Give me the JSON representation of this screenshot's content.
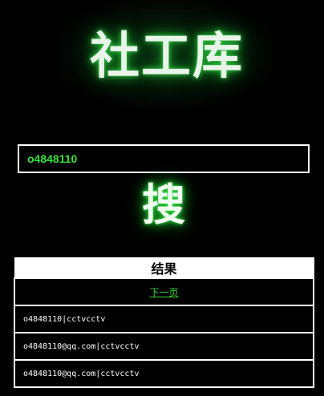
{
  "logo": {
    "text": "社工库",
    "glow_color": "#1fc52e",
    "text_color": "#e9f5ea"
  },
  "search": {
    "value": "o4848110",
    "text_color": "#37e03a"
  },
  "search_button": {
    "label": "搜"
  },
  "results": {
    "header": "结果",
    "pager_link": "下一页",
    "rows": [
      {
        "text": "o4848110|cctvcctv"
      },
      {
        "text": "o4848110@qq.com|cctvcctv"
      },
      {
        "text": "o4848110@qq.com|cctvcctv"
      }
    ]
  }
}
